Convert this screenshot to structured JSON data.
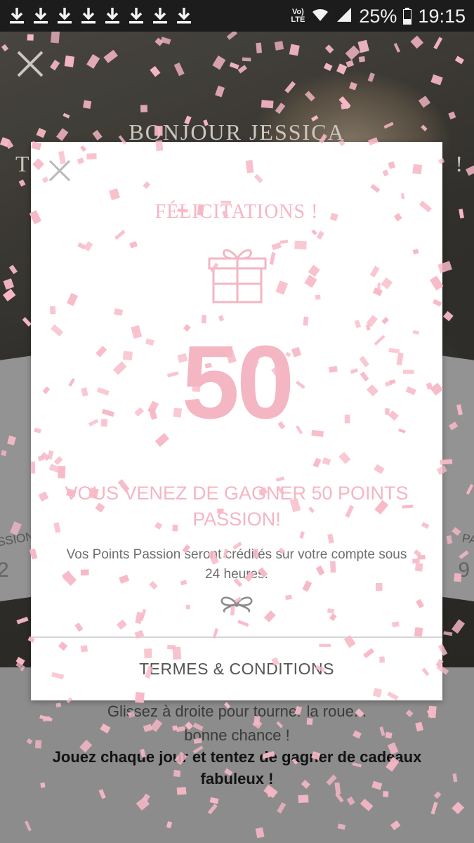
{
  "status_bar": {
    "network": "Vo) LTE",
    "battery_percent": "25%",
    "time": "19:15",
    "download_count": 8,
    "icons": [
      "download-icon",
      "wifi-icon",
      "signal-icon",
      "battery-icon"
    ]
  },
  "background": {
    "greeting": "BONJOUR JESSICA",
    "line2_left": "T",
    "line2_right": "!",
    "wheel_left_label": "SSION",
    "wheel_left_number": "2",
    "wheel_right_label": "PA",
    "wheel_right_number": "9",
    "hint_line1": "Glissez à droite pour tourner la roue...",
    "hint_line2": "bonne chance !",
    "bold_message": "Jouez chaque jour et tentez de gagner de cadeaux fabuleux !"
  },
  "modal": {
    "title": "FÉLICITATIONS !",
    "points": "50",
    "win_message": "VOUS VENEZ DE GAGNER 50 POINTS PASSION!",
    "info": "Vos Points Passion seront crédités sur votre compte sous 24 heures.",
    "terms_label": "TERMES & CONDITIONS"
  },
  "colors": {
    "accent_pink": "#f4b6c3",
    "confetti": "#f7b8c6",
    "status_bar": "#1c1c1c",
    "background_grey": "#959595"
  }
}
